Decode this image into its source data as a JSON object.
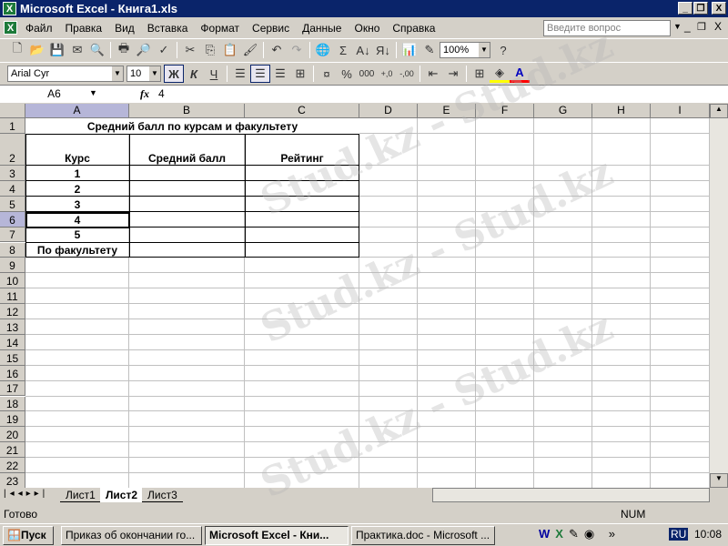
{
  "title": "Microsoft Excel - Книга1.xls",
  "menu": [
    "Файл",
    "Правка",
    "Вид",
    "Вставка",
    "Формат",
    "Сервис",
    "Данные",
    "Окно",
    "Справка"
  ],
  "ask_placeholder": "Введите вопрос",
  "zoom": "100%",
  "font_name": "Arial Cyr",
  "font_size": "10",
  "format_buttons": {
    "bold": "Ж",
    "italic": "К",
    "underline": "Ч"
  },
  "name_box": "A6",
  "fx": "fx",
  "formula": "4",
  "columns": [
    "A",
    "B",
    "C",
    "D",
    "E",
    "F",
    "G",
    "H",
    "I"
  ],
  "rows": [
    "1",
    "2",
    "3",
    "4",
    "5",
    "6",
    "7",
    "8",
    "9",
    "10",
    "11",
    "12",
    "13",
    "14",
    "15",
    "16",
    "17",
    "18",
    "19",
    "20",
    "21",
    "22",
    "23"
  ],
  "cells": {
    "title": "Средний балл по курсам и факультету",
    "h_course": "Курс",
    "h_avg": "Средний балл",
    "h_rating": "Рейтинг",
    "c1": "1",
    "c2": "2",
    "c3": "3",
    "c4": "4",
    "c5": "5",
    "faculty": "По факультету"
  },
  "sheets": [
    "Лист1",
    "Лист2",
    "Лист3"
  ],
  "status": "Готово",
  "num": "NUM",
  "taskbar": {
    "start": "Пуск",
    "tasks": [
      "Приказ об окончании го...",
      "Microsoft Excel - Кни...",
      "Практика.doc - Microsoft ..."
    ],
    "lang": "RU",
    "clock": "10:08"
  },
  "watermark": "Stud.kz - Stud.kz"
}
